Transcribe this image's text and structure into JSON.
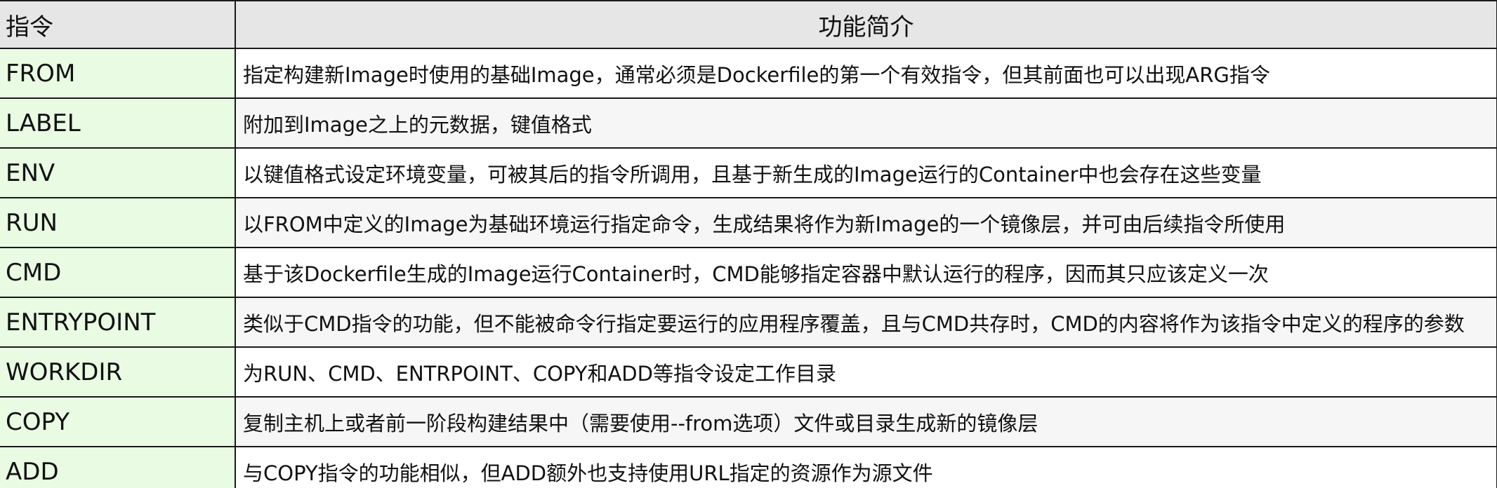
{
  "table": {
    "headers": {
      "command": "指令",
      "description": "功能简介"
    },
    "rows": [
      {
        "command": "FROM",
        "description": "指定构建新Image时使用的基础Image，通常必须是Dockerfile的第一个有效指令，但其前面也可以出现ARG指令"
      },
      {
        "command": "LABEL",
        "description": "附加到Image之上的元数据，键值格式"
      },
      {
        "command": "ENV",
        "description": "以键值格式设定环境变量，可被其后的指令所调用，且基于新生成的Image运行的Container中也会存在这些变量"
      },
      {
        "command": "RUN",
        "description": "以FROM中定义的Image为基础环境运行指定命令，生成结果将作为新Image的一个镜像层，并可由后续指令所使用"
      },
      {
        "command": "CMD",
        "description": "基于该Dockerfile生成的Image运行Container时，CMD能够指定容器中默认运行的程序，因而其只应该定义一次"
      },
      {
        "command": "ENTRYPOINT",
        "description": "类似于CMD指令的功能，但不能被命令行指定要运行的应用程序覆盖，且与CMD共存时，CMD的内容将作为该指令中定义的程序的参数"
      },
      {
        "command": "WORKDIR",
        "description": "为RUN、CMD、ENTRPOINT、COPY和ADD等指令设定工作目录"
      },
      {
        "command": "COPY",
        "description": "复制主机上或者前一阶段构建结果中（需要使用--from选项）文件或目录生成新的镜像层"
      },
      {
        "command": "ADD",
        "description": "与COPY指令的功能相似，但ADD额外也支持使用URL指定的资源作为源文件"
      }
    ]
  },
  "colors": {
    "header_bg": "#e6e6e6",
    "command_bg": "#e9fbe3",
    "border": "#1a1a1a"
  }
}
